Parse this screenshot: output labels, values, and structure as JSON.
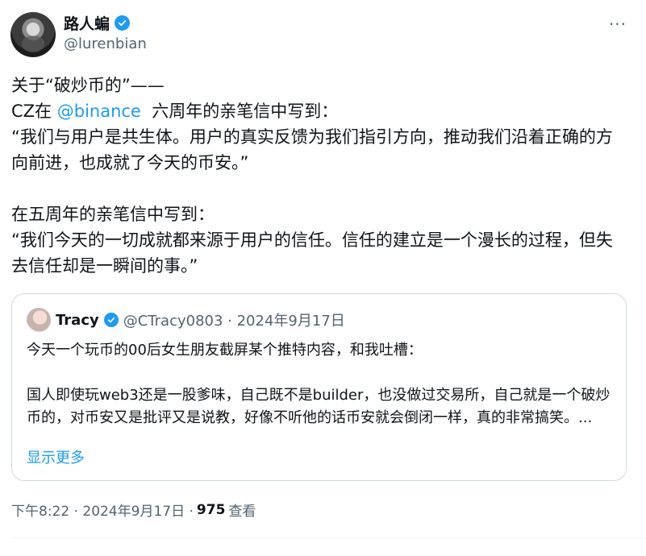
{
  "author": {
    "display_name": "路人蝙",
    "handle": "@lurenbian"
  },
  "tweet": {
    "line1": "关于“破炒币的”——",
    "line2_prefix": "CZ在 ",
    "line2_mention": "@binance",
    "line2_suffix": "  六周年的亲笔信中写到：",
    "para1": "“我们与用户是共生体。用户的真实反馈为我们指引方向，推动我们沿着正确的方向前进，也成就了今天的币安。”",
    "para2_intro": "在五周年的亲笔信中写到：",
    "para2": "“我们今天的一切成就都来源于用户的信任。信任的建立是一个漫长的过程，但失去信任却是一瞬间的事。”"
  },
  "quote": {
    "name": "Tracy",
    "meta": "@CTracy0803 · 2024年9月17日",
    "text1": "今天一个玩币的00后女生朋友截屏某个推特内容，和我吐槽：",
    "text2": "国人即使玩web3还是一股爹味，自己既不是builder，也没做过交易所，自己就是一个破炒币的，对币安又是批评又是说教，好像不听他的话币安就会倒闭一样，真的非常搞笑。...",
    "show_more": "显示更多"
  },
  "footer": {
    "time": "下午8:22 · 2024年9月17日 · ",
    "views_count": "975",
    "views_label": " 查看"
  },
  "menu": {
    "more": "···"
  },
  "colors": {
    "accent": "#1d9bf0",
    "secondary_text": "#536471",
    "border": "#cfd9de"
  },
  "icons": [
    "verified-badge-icon",
    "more-options-icon"
  ]
}
